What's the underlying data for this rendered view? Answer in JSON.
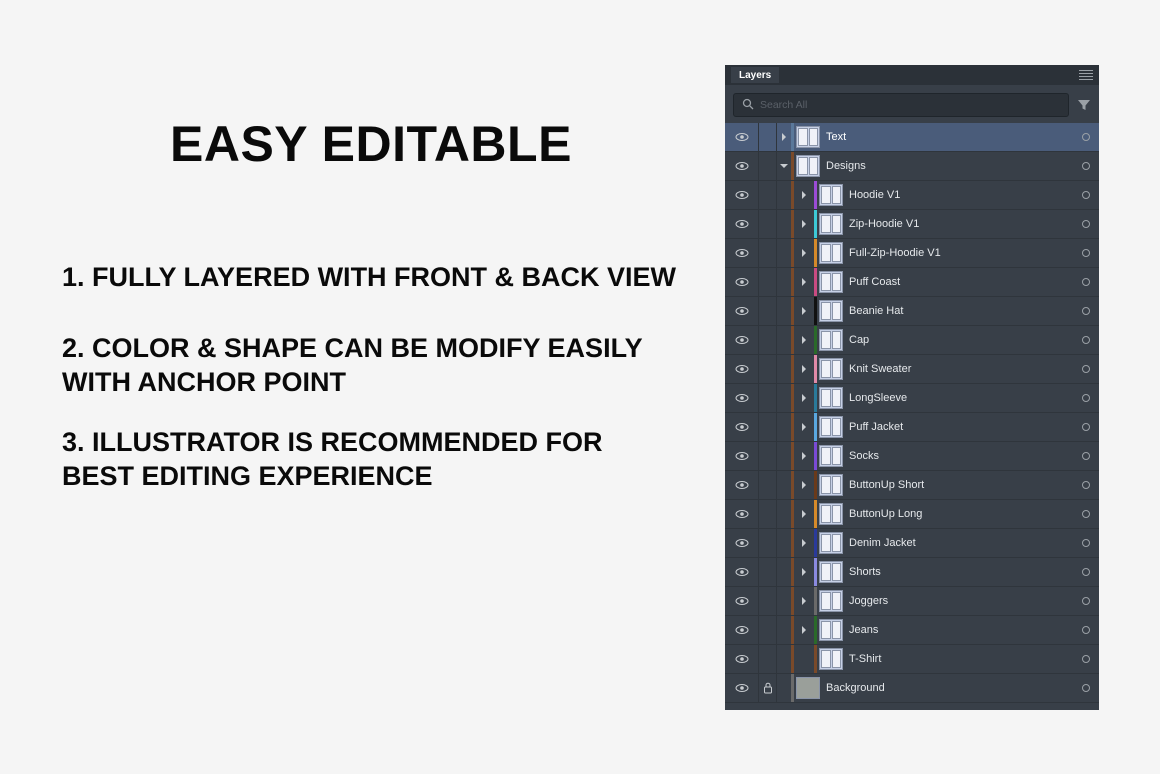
{
  "main": {
    "title": "EASY EDITABLE",
    "features": [
      "1.  FULLY LAYERED WITH FRONT & BACK VIEW",
      "2. COLOR & SHAPE CAN BE MODIFY EASILY WITH ANCHOR POINT",
      "3. ILLUSTRATOR IS RECOMMENDED FOR BEST EDITING EXPERIENCE"
    ]
  },
  "layers_panel": {
    "tab": "Layers",
    "search_placeholder": "Search All",
    "layers": [
      {
        "name": "Text",
        "depth": 0,
        "twisty": "closed",
        "color": "#5a789a",
        "selected": true,
        "locked": false,
        "bg": false
      },
      {
        "name": "Designs",
        "depth": 0,
        "twisty": "open",
        "color": "#7a4a2a",
        "selected": false,
        "locked": false,
        "bg": false
      },
      {
        "name": "Hoodie V1",
        "depth": 1,
        "twisty": "closed",
        "color": "#9b4bd6",
        "selected": false,
        "locked": false,
        "bg": false
      },
      {
        "name": "Zip-Hoodie V1",
        "depth": 1,
        "twisty": "closed",
        "color": "#3dc9d6",
        "selected": false,
        "locked": false,
        "bg": false
      },
      {
        "name": "Full-Zip-Hoodie V1",
        "depth": 1,
        "twisty": "closed",
        "color": "#d68a2a",
        "selected": false,
        "locked": false,
        "bg": false
      },
      {
        "name": "Puff Coast",
        "depth": 1,
        "twisty": "closed",
        "color": "#c94b82",
        "selected": false,
        "locked": false,
        "bg": false
      },
      {
        "name": "Beanie Hat",
        "depth": 1,
        "twisty": "closed",
        "color": "#111111",
        "selected": false,
        "locked": false,
        "bg": false
      },
      {
        "name": "Cap",
        "depth": 1,
        "twisty": "closed",
        "color": "#2a6a2a",
        "selected": false,
        "locked": false,
        "bg": false
      },
      {
        "name": "Knit Sweater",
        "depth": 1,
        "twisty": "closed",
        "color": "#e08aa8",
        "selected": false,
        "locked": false,
        "bg": false
      },
      {
        "name": "LongSleeve",
        "depth": 1,
        "twisty": "closed",
        "color": "#2a7a9a",
        "selected": false,
        "locked": false,
        "bg": false
      },
      {
        "name": "Puff Jacket",
        "depth": 1,
        "twisty": "closed",
        "color": "#5aa8e0",
        "selected": false,
        "locked": false,
        "bg": false
      },
      {
        "name": "Socks",
        "depth": 1,
        "twisty": "closed",
        "color": "#7a4ad6",
        "selected": false,
        "locked": false,
        "bg": false
      },
      {
        "name": "ButtonUp Short",
        "depth": 1,
        "twisty": "closed",
        "color": "#6a3a1a",
        "selected": false,
        "locked": false,
        "bg": false
      },
      {
        "name": "ButtonUp Long",
        "depth": 1,
        "twisty": "closed",
        "color": "#d68a2a",
        "selected": false,
        "locked": false,
        "bg": false
      },
      {
        "name": "Denim Jacket",
        "depth": 1,
        "twisty": "closed",
        "color": "#2a3a9a",
        "selected": false,
        "locked": false,
        "bg": false
      },
      {
        "name": "Shorts",
        "depth": 1,
        "twisty": "closed",
        "color": "#8a8ae0",
        "selected": false,
        "locked": false,
        "bg": false
      },
      {
        "name": "Joggers",
        "depth": 1,
        "twisty": "closed",
        "color": "#6a6a6a",
        "selected": false,
        "locked": false,
        "bg": false
      },
      {
        "name": "Jeans",
        "depth": 1,
        "twisty": "closed",
        "color": "#2a6a2a",
        "selected": false,
        "locked": false,
        "bg": false
      },
      {
        "name": "T-Shirt",
        "depth": 1,
        "twisty": "none",
        "color": "#7a4a2a",
        "selected": false,
        "locked": false,
        "bg": false
      },
      {
        "name": "Background",
        "depth": 0,
        "twisty": "none",
        "color": "#6a6a6a",
        "selected": false,
        "locked": true,
        "bg": true
      }
    ]
  }
}
